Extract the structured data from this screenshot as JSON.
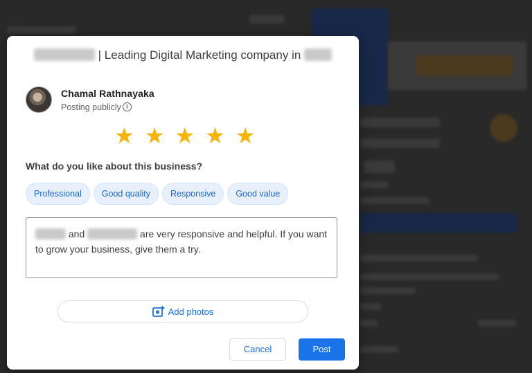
{
  "dialog": {
    "title_suffix": "| Leading Digital Marketing company in",
    "user": {
      "name": "Chamal Rathnayaka",
      "posting_status": "Posting publicly",
      "info_icon": "info-icon"
    },
    "rating": {
      "stars": 5,
      "max": 5,
      "star_glyph": "★",
      "color": "#f5b400"
    },
    "question": "What do you like about this business?",
    "chips": [
      "Professional",
      "Good quality",
      "Responsive",
      "Good value"
    ],
    "review": {
      "connector": "and",
      "text_line1_rest": "are very responsive and helpful. If you want",
      "text_line2": "to grow your business, give them a try."
    },
    "add_photos_label": "Add photos",
    "cancel_label": "Cancel",
    "post_label": "Post"
  },
  "colors": {
    "accent": "#1a73e8",
    "chip_bg": "#e8f0fe",
    "overlay": "rgba(0,0,0,0.45)"
  }
}
